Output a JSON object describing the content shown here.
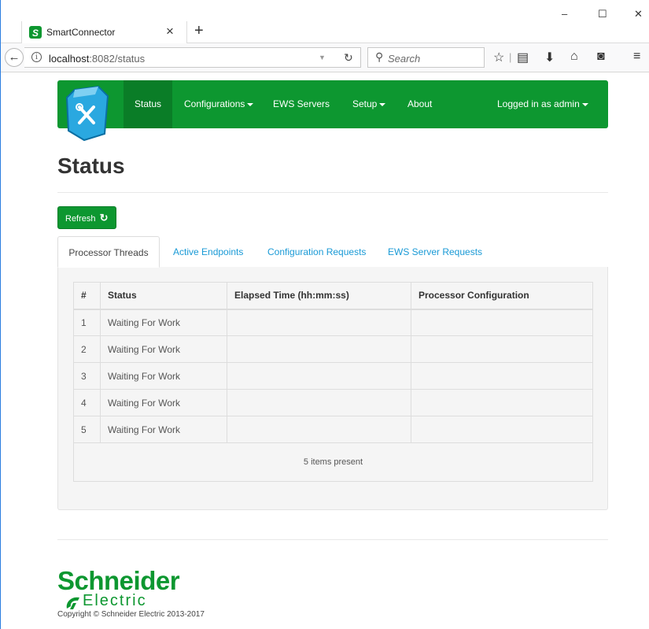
{
  "browser": {
    "tab_title": "SmartConnector",
    "url_host": "localhost",
    "url_rest": ":8082/status",
    "search_placeholder": "Search",
    "window_controls": {
      "minimize": "–",
      "maximize": "☐",
      "close": "✕"
    },
    "icons": [
      "star-icon",
      "reading-list-icon",
      "download-icon",
      "home-icon",
      "pocket-icon",
      "menu-icon"
    ]
  },
  "nav": {
    "items": [
      {
        "label": "Status",
        "active": true
      },
      {
        "label": "Configurations",
        "dropdown": true
      },
      {
        "label": "EWS Servers"
      },
      {
        "label": "Setup",
        "dropdown": true
      },
      {
        "label": "About"
      }
    ],
    "user": "Logged in as admin"
  },
  "page": {
    "title": "Status",
    "refresh_label": "Refresh"
  },
  "tabs": [
    "Processor Threads",
    "Active Endpoints",
    "Configuration Requests",
    "EWS Server Requests"
  ],
  "table": {
    "columns": [
      "#",
      "Status",
      "Elapsed Time (hh:mm:ss)",
      "Processor Configuration"
    ],
    "rows": [
      {
        "n": "1",
        "status": "Waiting For Work",
        "elapsed": "",
        "config": ""
      },
      {
        "n": "2",
        "status": "Waiting For Work",
        "elapsed": "",
        "config": ""
      },
      {
        "n": "3",
        "status": "Waiting For Work",
        "elapsed": "",
        "config": ""
      },
      {
        "n": "4",
        "status": "Waiting For Work",
        "elapsed": "",
        "config": ""
      },
      {
        "n": "5",
        "status": "Waiting For Work",
        "elapsed": "",
        "config": ""
      }
    ],
    "footer": "5 items present"
  },
  "footer": {
    "logo_line1": "Schneider",
    "logo_line2": "Electric",
    "copyright": "Copyright © Schneider Electric 2013-2017"
  },
  "colors": {
    "brand_green": "#0d9730",
    "link_blue": "#1a9ad6"
  }
}
